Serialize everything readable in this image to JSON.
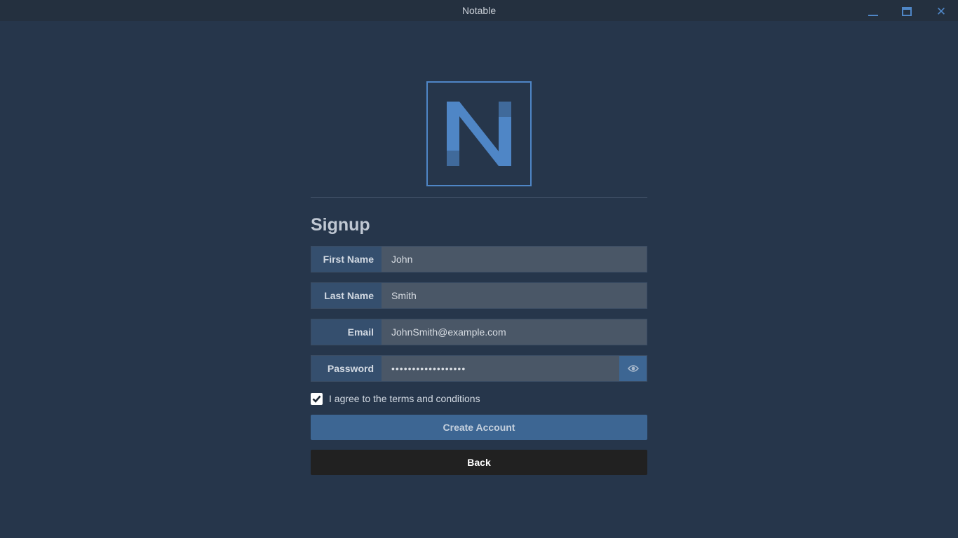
{
  "window": {
    "title": "Notable",
    "controls": {
      "minimize": "minimize-icon",
      "maximize": "maximize-icon",
      "close": "close-icon"
    }
  },
  "logo": {
    "letter": "N",
    "color": "#4f86c6"
  },
  "form": {
    "heading": "Signup",
    "fields": [
      {
        "label": "First Name",
        "value": "John"
      },
      {
        "label": "Last Name",
        "value": "Smith"
      },
      {
        "label": "Email",
        "value": "JohnSmith@example.com"
      },
      {
        "label": "Password",
        "value": "••••••••••••••••••",
        "toggle_icon": "eye-icon"
      }
    ],
    "agree": {
      "checked": true,
      "label": "I agree to the terms and conditions"
    },
    "create_label": "Create Account",
    "back_label": "Back"
  },
  "colors": {
    "background": "#26364b",
    "titlebar": "#24303f",
    "accent": "#4f86c6",
    "button_primary": "#3d6693",
    "button_back": "#212121"
  }
}
